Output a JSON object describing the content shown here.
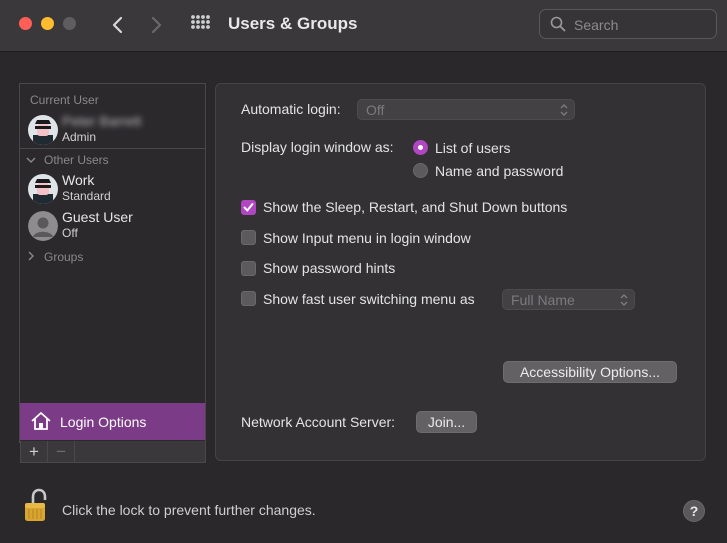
{
  "window": {
    "title": "Users & Groups",
    "search_placeholder": "Search"
  },
  "sidebar": {
    "current_user_label": "Current User",
    "current_user": {
      "name": "Peter Barrett",
      "role": "Admin"
    },
    "other_users_label": "Other Users",
    "other_users": [
      {
        "name": "Work",
        "role": "Standard"
      },
      {
        "name": "Guest User",
        "role": "Off"
      }
    ],
    "groups_label": "Groups",
    "login_options_label": "Login Options",
    "add_label": "+",
    "remove_label": "−"
  },
  "login_options": {
    "automatic_login_label": "Automatic login:",
    "automatic_login_value": "Off",
    "display_window_label": "Display login window as:",
    "display_options": [
      "List of users",
      "Name and password"
    ],
    "display_selected": "List of users",
    "checkboxes": [
      {
        "label": "Show the Sleep, Restart, and Shut Down buttons",
        "checked": true
      },
      {
        "label": "Show Input menu in login window",
        "checked": false
      },
      {
        "label": "Show password hints",
        "checked": false
      },
      {
        "label": "Show fast user switching menu as",
        "checked": false
      }
    ],
    "fast_switching_value": "Full Name",
    "accessibility_button": "Accessibility Options...",
    "network_server_label": "Network Account Server:",
    "join_button": "Join..."
  },
  "footer": {
    "lock_text": "Click the lock to prevent further changes.",
    "help_label": "?"
  },
  "colors": {
    "accent": "#b146c2",
    "selection": "#7b3b86"
  }
}
